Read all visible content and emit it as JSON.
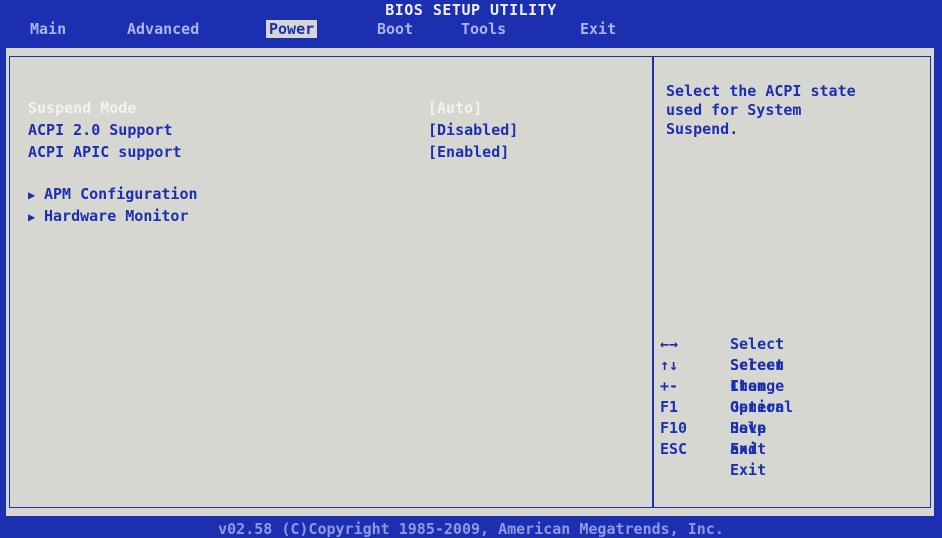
{
  "title": "BIOS SETUP UTILITY",
  "menu": [
    {
      "label": "Main"
    },
    {
      "label": "Advanced"
    },
    {
      "label": "Power"
    },
    {
      "label": "Boot"
    },
    {
      "label": "Tools"
    },
    {
      "label": "Exit"
    }
  ],
  "settings": [
    {
      "label": "Suspend Mode",
      "value": "[Auto]"
    },
    {
      "label": "ACPI 2.0 Support",
      "value": "[Disabled]"
    },
    {
      "label": "ACPI APIC support",
      "value": "[Enabled]"
    }
  ],
  "submenus": [
    {
      "arrow": "▶",
      "label": "APM Configuration"
    },
    {
      "arrow": "▶",
      "label": "Hardware Monitor"
    }
  ],
  "help_text": "Select the ACPI state\nused for System\nSuspend.",
  "keys": [
    {
      "key": "←→",
      "desc": "Select Screen"
    },
    {
      "key": "↑↓",
      "desc": "Select Item"
    },
    {
      "key": "+-",
      "desc": "Change Option"
    },
    {
      "key": "F1",
      "desc": "General Help"
    },
    {
      "key": "F10",
      "desc": "Save and Exit"
    },
    {
      "key": "ESC",
      "desc": "Exit"
    }
  ],
  "footer": "v02.58 (C)Copyright 1985-2009, American Megatrends, Inc.",
  "colors": {
    "background": "#1c2fb0",
    "panel": "#d7d7d2",
    "text": "#1c2fb0",
    "selected_text": "#f2f2ef"
  }
}
